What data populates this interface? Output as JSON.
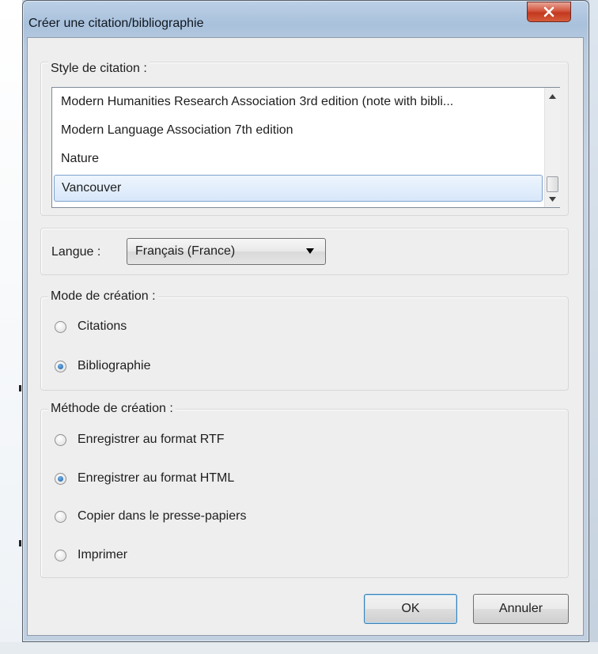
{
  "dialog": {
    "title": "Créer une citation/bibliographie",
    "close_label": "X"
  },
  "citation_style": {
    "legend": "Style de citation :",
    "items": [
      "Modern Humanities Research Association 3rd edition (note with bibli...",
      "Modern Language Association 7th edition",
      "Nature",
      "Vancouver"
    ],
    "selected": "Vancouver"
  },
  "language": {
    "label": "Langue :",
    "selected": "Français (France)"
  },
  "mode": {
    "legend": "Mode de création :",
    "options": [
      "Citations",
      "Bibliographie"
    ],
    "selected": "Bibliographie"
  },
  "method": {
    "legend": "Méthode de création :",
    "options": [
      "Enregistrer au format RTF",
      "Enregistrer au format HTML",
      "Copier dans le presse-papiers",
      "Imprimer"
    ],
    "selected": "Enregistrer au format HTML"
  },
  "buttons": {
    "ok": "OK",
    "cancel": "Annuler"
  },
  "icons": {
    "close": "close-icon",
    "scroll_up": "scroll-up-arrow-icon",
    "scroll_down": "scroll-down-arrow-icon",
    "dropdown": "chevron-down-icon"
  }
}
